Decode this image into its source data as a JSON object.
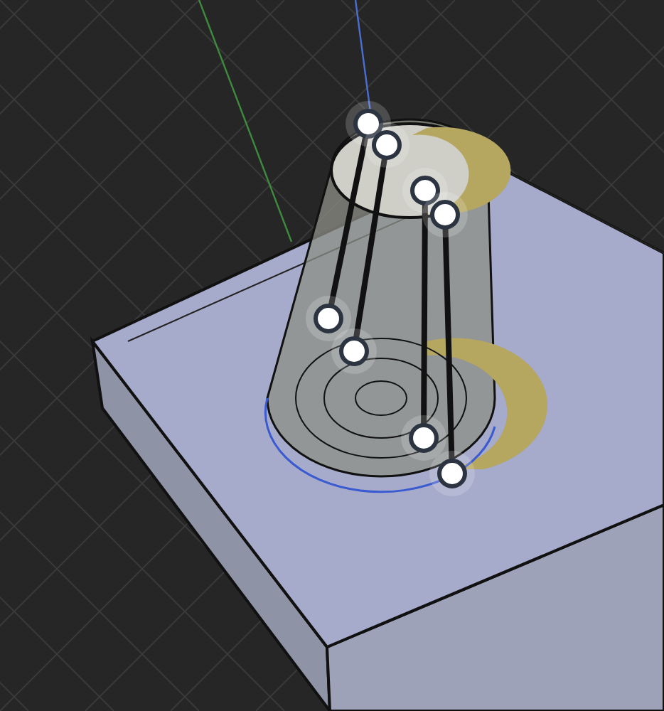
{
  "viewport": {
    "grid": true,
    "axes": true,
    "handles": [
      {
        "selected": false
      },
      {
        "selected": false
      },
      {
        "selected": false
      },
      {
        "selected": false
      },
      {
        "selected": false
      },
      {
        "selected": false
      },
      {
        "selected": false
      },
      {
        "selected": false
      }
    ]
  }
}
